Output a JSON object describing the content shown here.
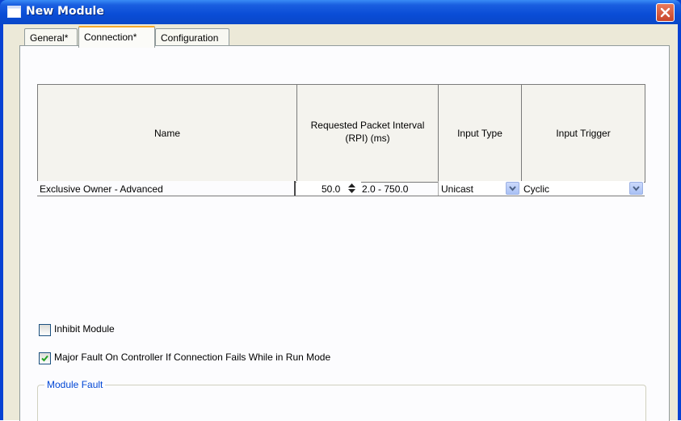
{
  "window": {
    "title": "New Module",
    "title_icon": "window-icon",
    "close_icon": "close-icon"
  },
  "tabs": [
    {
      "label": "General*"
    },
    {
      "label": "Connection*",
      "active": true
    },
    {
      "label": "Configuration"
    }
  ],
  "grid": {
    "columns": {
      "name": "Name",
      "rpi_line1": "Requested Packet Interval",
      "rpi_line2": "(RPI) (ms)",
      "input_type": "Input Type",
      "input_trigger": "Input Trigger"
    },
    "rows": [
      {
        "name": "Exclusive Owner - Advanced",
        "rpi_value": "50.0",
        "rpi_range": "2.0 - 750.0",
        "input_type": "Unicast",
        "input_trigger": "Cyclic"
      }
    ]
  },
  "options": {
    "inhibit_module": {
      "label": "Inhibit Module",
      "checked": false
    },
    "major_fault": {
      "label": "Major Fault On Controller If Connection Fails While in Run Mode",
      "checked": true
    }
  },
  "module_fault": {
    "label": "Module Fault"
  },
  "colors": {
    "titlebar": "#0a4cd6",
    "dialog_bg": "#ece9d8",
    "active_tab_accent": "#f6a82a",
    "groupbox_label": "#0046d5"
  }
}
